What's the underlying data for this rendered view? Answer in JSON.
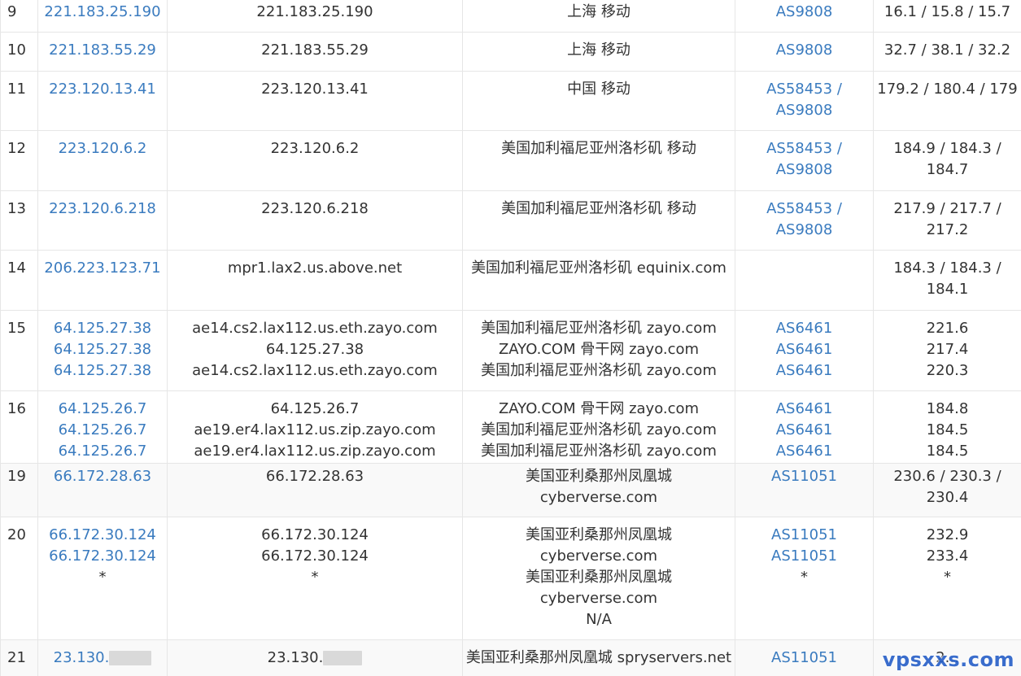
{
  "rows": [
    {
      "hop": "9",
      "ip": [
        "221.183.25.190"
      ],
      "host": [
        "221.183.25.190"
      ],
      "loc": [
        "上海 移动"
      ],
      "as": [
        "AS9808"
      ],
      "time": "16.1 / 15.8 / 15.7"
    },
    {
      "hop": "10",
      "ip": [
        "221.183.55.29"
      ],
      "host": [
        "221.183.55.29"
      ],
      "loc": [
        "上海 移动"
      ],
      "as": [
        "AS9808"
      ],
      "time": "32.7 / 38.1 / 32.2"
    },
    {
      "hop": "11",
      "ip": [
        "223.120.13.41"
      ],
      "host": [
        "223.120.13.41"
      ],
      "loc": [
        "中国 移动"
      ],
      "as": [
        "AS58453 /",
        "AS9808"
      ],
      "time": "179.2 / 180.4 / 179"
    },
    {
      "hop": "12",
      "ip": [
        "223.120.6.2"
      ],
      "host": [
        "223.120.6.2"
      ],
      "loc": [
        "美国加利福尼亚州洛杉矶 移动"
      ],
      "as": [
        "AS58453 /",
        "AS9808"
      ],
      "time": "184.9 / 184.3 / 184.7"
    },
    {
      "hop": "13",
      "ip": [
        "223.120.6.218"
      ],
      "host": [
        "223.120.6.218"
      ],
      "loc": [
        "美国加利福尼亚州洛杉矶 移动"
      ],
      "as": [
        "AS58453 /",
        "AS9808"
      ],
      "time": "217.9 / 217.7 / 217.2"
    },
    {
      "hop": "14",
      "ip": [
        "206.223.123.71"
      ],
      "host": [
        "mpr1.lax2.us.above.net"
      ],
      "loc": [
        "美国加利福尼亚州洛杉矶 equinix.com"
      ],
      "as": [],
      "time": "184.3 / 184.3 / 184.1"
    },
    {
      "hop": "15",
      "ip": [
        "64.125.27.38",
        "64.125.27.38",
        "64.125.27.38"
      ],
      "host": [
        "ae14.cs2.lax112.us.eth.zayo.com",
        "64.125.27.38",
        "ae14.cs2.lax112.us.eth.zayo.com"
      ],
      "loc": [
        "美国加利福尼亚州洛杉矶 zayo.com",
        "ZAYO.COM 骨干网 zayo.com",
        "美国加利福尼亚州洛杉矶 zayo.com"
      ],
      "as": [
        "AS6461",
        "AS6461",
        "AS6461"
      ],
      "time_lines": [
        "221.6",
        "217.4",
        "220.3"
      ]
    },
    {
      "hop": "16",
      "ip": [
        "64.125.26.7",
        "64.125.26.7",
        "64.125.26.7"
      ],
      "host": [
        "64.125.26.7",
        "ae19.er4.lax112.us.zip.zayo.com",
        "ae19.er4.lax112.us.zip.zayo.com"
      ],
      "loc": [
        "ZAYO.COM 骨干网 zayo.com",
        "美国加利福尼亚州洛杉矶 zayo.com",
        "美国加利福尼亚州洛杉矶 zayo.com"
      ],
      "as": [
        "AS6461",
        "AS6461",
        "AS6461"
      ],
      "time_lines": [
        "184.8",
        "184.5",
        "184.5"
      ]
    },
    {
      "hop": "19",
      "ip": [
        "66.172.28.63"
      ],
      "host": [
        "66.172.28.63"
      ],
      "loc": [
        "美国亚利桑那州凤凰城",
        "cyberverse.com"
      ],
      "as": [
        "AS11051"
      ],
      "time": "230.6 / 230.3 / 230.4"
    },
    {
      "hop": "20",
      "ip": [
        "66.172.30.124",
        "66.172.30.124",
        "*"
      ],
      "host": [
        "66.172.30.124",
        "66.172.30.124",
        "*"
      ],
      "loc": [
        "美国亚利桑那州凤凰城",
        "cyberverse.com",
        "美国亚利桑那州凤凰城",
        "cyberverse.com",
        "N/A"
      ],
      "as": [
        "AS11051",
        "AS11051",
        "*"
      ],
      "time_lines": [
        "232.9",
        "233.4",
        "*"
      ]
    },
    {
      "hop": "21",
      "ip_prefix": "23.130.",
      "host_prefix": "23.130.",
      "loc": [
        "美国亚利桑那州凤凰城 spryservers.net"
      ],
      "as": [
        "AS11051"
      ],
      "time": "2..."
    }
  ],
  "watermark": "vpsxxs.com"
}
